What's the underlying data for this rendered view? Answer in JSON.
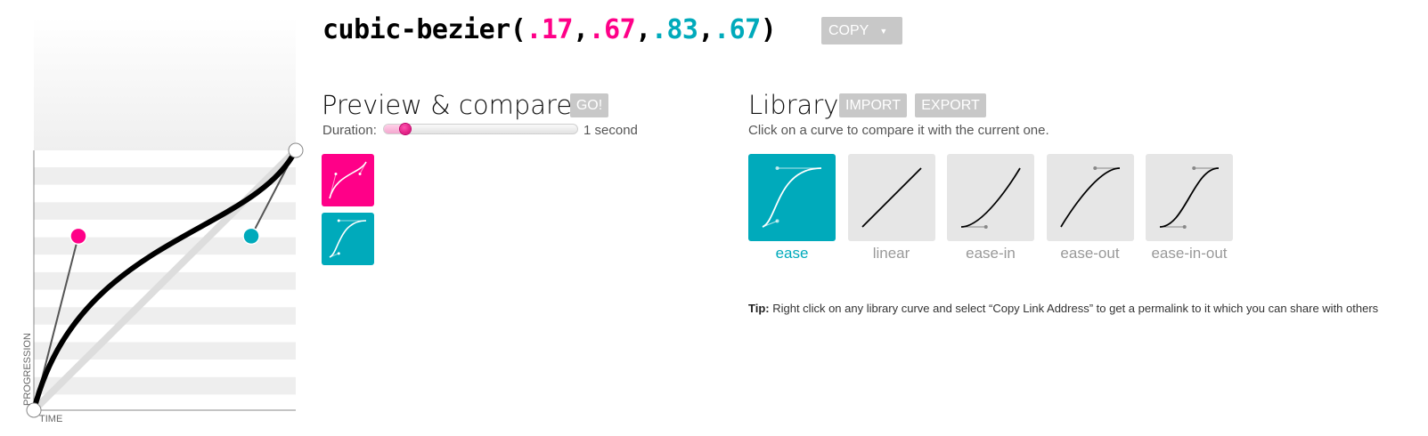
{
  "title": {
    "prefix": "cubic-bezier(",
    "p1x": ".17",
    "p1y": ".67",
    "p2x": ".83",
    "p2y": ".67",
    "suffix": ")",
    "sep": ","
  },
  "copy_button": {
    "label": "COPY",
    "caret": "▼"
  },
  "editor": {
    "y_axis_label": "PROGRESSION",
    "x_axis_label": "TIME",
    "control_points": {
      "p1": [
        0.17,
        0.67
      ],
      "p2": [
        0.83,
        0.67
      ]
    }
  },
  "preview": {
    "title": "Preview & compare",
    "go_label": "GO!",
    "duration_label": "Duration:",
    "duration_value": "1 second",
    "duration_fraction": 0.1
  },
  "library": {
    "title": "Library",
    "import_label": "IMPORT",
    "export_label": "EXPORT",
    "hint": "Click on a curve to compare it with the current one.",
    "items": [
      {
        "label": "ease",
        "p": [
          0.25,
          0.1,
          0.25,
          1
        ]
      },
      {
        "label": "linear",
        "p": [
          0,
          0,
          1,
          1
        ]
      },
      {
        "label": "ease-in",
        "p": [
          0.42,
          0,
          1,
          1
        ]
      },
      {
        "label": "ease-out",
        "p": [
          0,
          0,
          0.58,
          1
        ]
      },
      {
        "label": "ease-in-out",
        "p": [
          0.42,
          0,
          0.58,
          1
        ]
      }
    ]
  },
  "tip": {
    "bold": "Tip:",
    "text": "Right click on any library curve and select “Copy Link Address” to get a permalink to it which you can share with others"
  },
  "colors": {
    "pink": "#ff0088",
    "teal": "#00aabb"
  }
}
